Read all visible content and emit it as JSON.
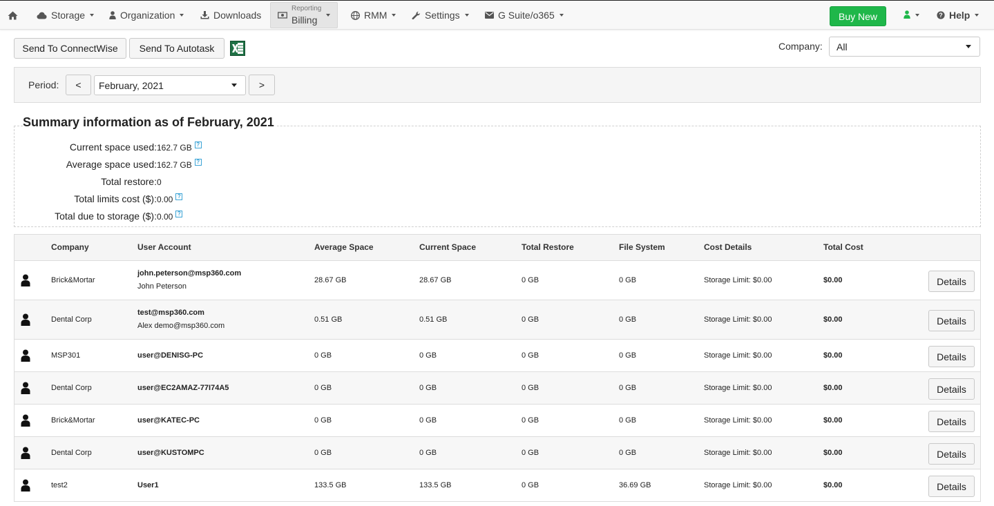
{
  "nav": {
    "storage": "Storage",
    "organization": "Organization",
    "downloads": "Downloads",
    "billing_small": "Reporting",
    "billing": "Billing",
    "rmm": "RMM",
    "settings": "Settings",
    "gsuite": "G Suite/o365",
    "buy_new": "Buy New",
    "help": "Help"
  },
  "toolbar": {
    "send_connectwise": "Send To ConnectWise",
    "send_autotask": "Send To Autotask",
    "company_label": "Company:",
    "company_value": "All"
  },
  "period": {
    "label": "Period:",
    "prev": "<",
    "value": "February, 2021",
    "next": ">"
  },
  "summary": {
    "title": "Summary information as of February, 2021",
    "current_space_label": "Current space used:",
    "current_space_value": "162.7 GB",
    "average_space_label": "Average space used:",
    "average_space_value": "162.7 GB",
    "total_restore_label": "Total restore:",
    "total_restore_value": "0",
    "limits_cost_label": "Total limits cost ($):",
    "limits_cost_value": "0.00",
    "due_storage_label": "Total due to storage ($):",
    "due_storage_value": "0.00",
    "help_glyph": "?"
  },
  "table": {
    "headers": {
      "company": "Company",
      "user_account": "User Account",
      "average_space": "Average Space",
      "current_space": "Current Space",
      "total_restore": "Total Restore",
      "file_system": "File System",
      "cost_details": "Cost Details",
      "total_cost": "Total Cost"
    },
    "details_label": "Details",
    "rows": [
      {
        "company": "Brick&Mortar",
        "account": "john.peterson@msp360.com",
        "account_sub": "John Peterson",
        "avg": "28.67 GB",
        "cur": "28.67 GB",
        "restore": "0 GB",
        "fs": "0 GB",
        "cost_details": "Storage Limit: $0.00",
        "total": "$0.00"
      },
      {
        "company": "Dental Corp",
        "account": "test@msp360.com",
        "account_sub": "Alex demo@msp360.com",
        "avg": "0.51 GB",
        "cur": "0.51 GB",
        "restore": "0 GB",
        "fs": "0 GB",
        "cost_details": "Storage Limit: $0.00",
        "total": "$0.00"
      },
      {
        "company": "MSP301",
        "account": "user@DENISG-PC",
        "account_sub": "",
        "avg": "0 GB",
        "cur": "0 GB",
        "restore": "0 GB",
        "fs": "0 GB",
        "cost_details": "Storage Limit: $0.00",
        "total": "$0.00"
      },
      {
        "company": "Dental Corp",
        "account": "user@EC2AMAZ-77I74A5",
        "account_sub": "",
        "avg": "0 GB",
        "cur": "0 GB",
        "restore": "0 GB",
        "fs": "0 GB",
        "cost_details": "Storage Limit: $0.00",
        "total": "$0.00"
      },
      {
        "company": "Brick&Mortar",
        "account": "user@KATEC-PC",
        "account_sub": "",
        "avg": "0 GB",
        "cur": "0 GB",
        "restore": "0 GB",
        "fs": "0 GB",
        "cost_details": "Storage Limit: $0.00",
        "total": "$0.00"
      },
      {
        "company": "Dental Corp",
        "account": "user@KUSTOMPC",
        "account_sub": "",
        "avg": "0 GB",
        "cur": "0 GB",
        "restore": "0 GB",
        "fs": "0 GB",
        "cost_details": "Storage Limit: $0.00",
        "total": "$0.00"
      },
      {
        "company": "test2",
        "account": "User1",
        "account_sub": "",
        "avg": "133.5 GB",
        "cur": "133.5 GB",
        "restore": "0 GB",
        "fs": "36.69 GB",
        "cost_details": "Storage Limit: $0.00",
        "total": "$0.00"
      }
    ]
  },
  "colors": {
    "buy_new": "#1fb74a",
    "user_status": "#1fb74a",
    "help_icon": "#3aa3d6",
    "excel": "#1e7145"
  }
}
